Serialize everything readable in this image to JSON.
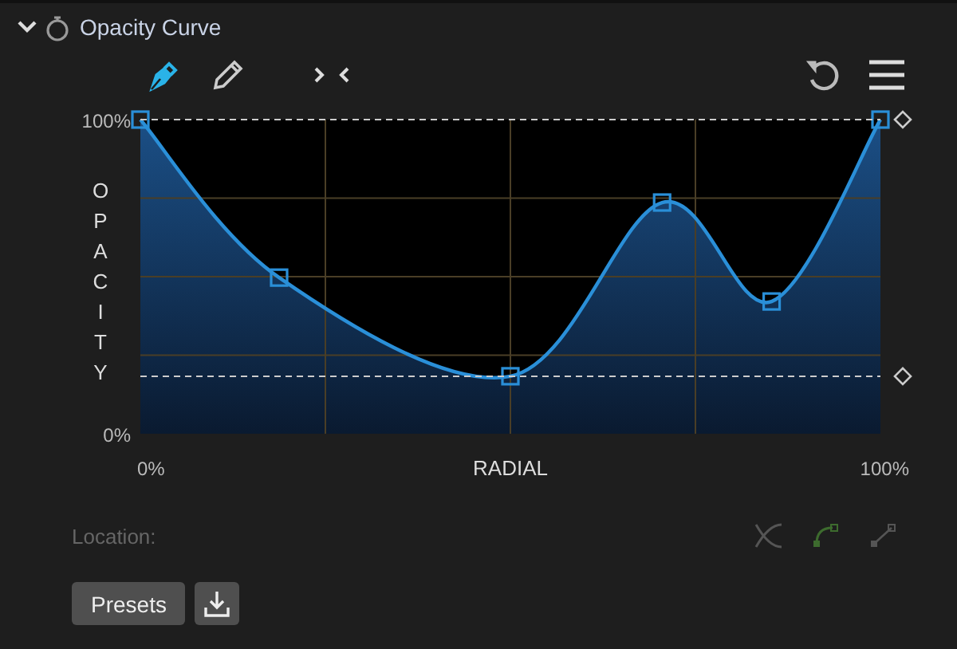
{
  "panel": {
    "title": "Opacity Curve",
    "expanded": true
  },
  "tools": [
    {
      "kind": "pen",
      "selected": true
    },
    {
      "kind": "pencil",
      "selected": false
    }
  ],
  "curve": {
    "y_axis_title": "OPACITY",
    "x_axis_title": "RADIAL",
    "y_ticks": [
      "100%",
      "0%"
    ],
    "x_ticks": [
      "0%",
      "100%"
    ]
  },
  "location": {
    "label": "Location:"
  },
  "buttons": {
    "presets": "Presets"
  }
}
